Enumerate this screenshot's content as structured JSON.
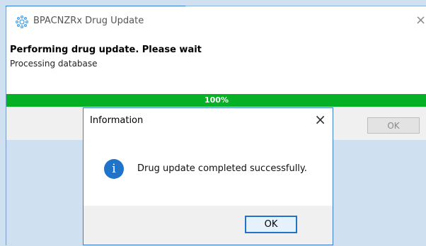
{
  "main_window": {
    "title": "BPACNZRx Drug Update",
    "status_main": "Performing drug update. Please wait",
    "status_sub": "Processing database",
    "progress_percent": 100,
    "progress_label": "100%",
    "ok_label": "OK",
    "icon": "gear-icon"
  },
  "info_dialog": {
    "title": "Information",
    "message": "Drug update completed successfully.",
    "ok_label": "OK",
    "icon": "info-icon"
  },
  "colors": {
    "progress": "#06b025",
    "accent": "#1f73c8"
  }
}
